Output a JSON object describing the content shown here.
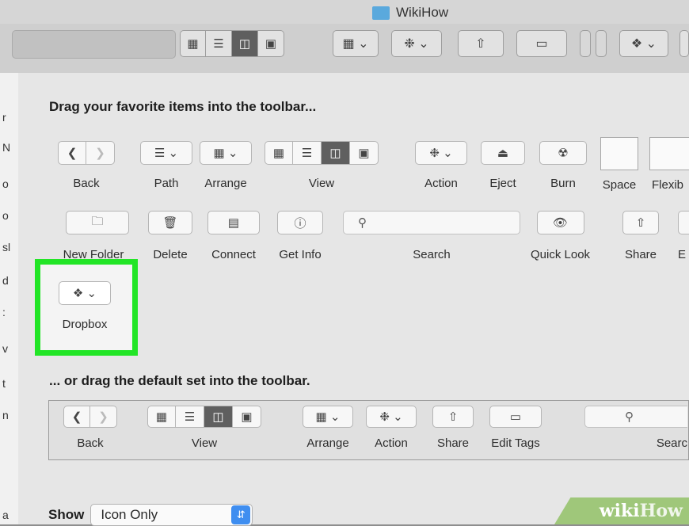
{
  "window": {
    "title": "WikiHow"
  },
  "window_toolbar": {
    "view_icons": [
      "icon-view-icon",
      "list-view-icon",
      "column-view-icon",
      "cover-flow-icon"
    ],
    "selected_view": "column-view-icon"
  },
  "sheet": {
    "heading": "Drag your favorite items into the toolbar...",
    "row1": {
      "back": "Back",
      "path": "Path",
      "arrange": "Arrange",
      "view": "View",
      "action": "Action",
      "eject": "Eject",
      "burn": "Burn",
      "space": "Space",
      "flexible_space": "Flexib"
    },
    "row2": {
      "new_folder": "New Folder",
      "delete": "Delete",
      "connect": "Connect",
      "get_info": "Get Info",
      "search": "Search",
      "quick_look": "Quick Look",
      "share": "Share",
      "edit_tags": "E"
    },
    "dropbox": "Dropbox",
    "default_heading": "... or drag the default set into the toolbar.",
    "default_set": {
      "back": "Back",
      "view": "View",
      "arrange": "Arrange",
      "action": "Action",
      "share": "Share",
      "edit_tags": "Edit Tags",
      "search": "Searc"
    },
    "show_label": "Show",
    "show_value": "Icon Only"
  },
  "left_strip_letters": [
    "r",
    "N",
    "o",
    "o",
    "sl",
    "d",
    ":",
    "v",
    "t",
    "n",
    "a"
  ],
  "watermark": {
    "part1": "wiki",
    "part2": "How"
  },
  "colors": {
    "highlight": "#22e526",
    "accent": "#3f8ef0",
    "selected_segment": "#5f5f5f"
  }
}
